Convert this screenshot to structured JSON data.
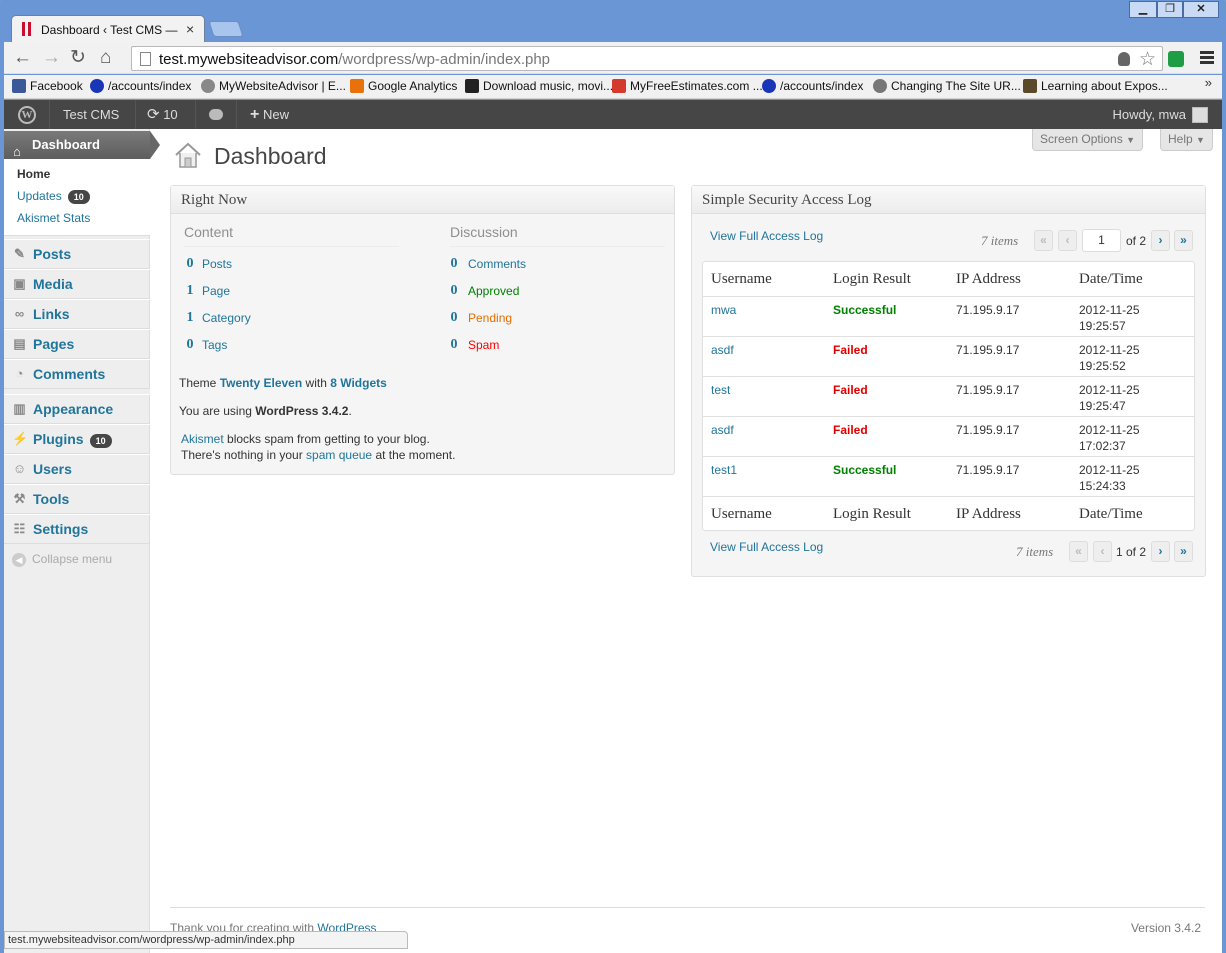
{
  "browser": {
    "tab_title": "Dashboard ‹ Test CMS — Wo",
    "url_host": "test.mywebsiteadvisor.com",
    "url_path": "/wordpress/wp-admin/index.php",
    "status_url": "test.mywebsiteadvisor.com/wordpress/wp-admin/index.php",
    "bookmarks": [
      {
        "label": "Facebook",
        "icon": "facebook-icon",
        "color": "#3b5998"
      },
      {
        "label": "/accounts/index",
        "icon": "e-icon",
        "color": "#1a36b8"
      },
      {
        "label": "MyWebsiteAdvisor | E...",
        "icon": "gear-icon",
        "color": "#888888"
      },
      {
        "label": "Google Analytics",
        "icon": "analytics-icon",
        "color": "#e8710a"
      },
      {
        "label": "Download music, movi...",
        "icon": "invader-icon",
        "color": "#222222"
      },
      {
        "label": "MyFreeEstimates.com ...",
        "icon": "rainbow-icon",
        "color": "#d33a2c"
      },
      {
        "label": "/accounts/index",
        "icon": "e-icon",
        "color": "#1a36b8"
      },
      {
        "label": "Changing The Site UR...",
        "icon": "wordpress-icon",
        "color": "#777777"
      },
      {
        "label": "Learning about Expos...",
        "icon": "ds-icon",
        "color": "#5b4a2a"
      }
    ]
  },
  "adminbar": {
    "site_name": "Test CMS",
    "updates_count": "10",
    "new_label": "New",
    "howdy": "Howdy, mwa"
  },
  "sidebar": {
    "header": "Dashboard",
    "submenu": {
      "home": "Home",
      "updates": "Updates",
      "updates_badge": "10",
      "akismet": "Akismet Stats"
    },
    "items": [
      {
        "label": "Posts",
        "icon": "pin-icon"
      },
      {
        "label": "Media",
        "icon": "media-icon"
      },
      {
        "label": "Links",
        "icon": "link-icon"
      },
      {
        "label": "Pages",
        "icon": "pages-icon"
      },
      {
        "label": "Comments",
        "icon": "comment-icon"
      },
      {
        "label": "Appearance",
        "icon": "appearance-icon"
      },
      {
        "label": "Plugins",
        "icon": "plugin-icon",
        "badge": "10"
      },
      {
        "label": "Users",
        "icon": "users-icon"
      },
      {
        "label": "Tools",
        "icon": "tools-icon"
      },
      {
        "label": "Settings",
        "icon": "settings-icon"
      }
    ],
    "collapse": "Collapse menu"
  },
  "main": {
    "title": "Dashboard",
    "screen_options": "Screen Options",
    "help": "Help",
    "right_now": {
      "title": "Right Now",
      "content_heading": "Content",
      "discussion_heading": "Discussion",
      "content": [
        {
          "count": "0",
          "label": "Posts"
        },
        {
          "count": "1",
          "label": "Page"
        },
        {
          "count": "1",
          "label": "Category"
        },
        {
          "count": "0",
          "label": "Tags"
        }
      ],
      "discussion": [
        {
          "count": "0",
          "label": "Comments",
          "color": "#21759b"
        },
        {
          "count": "0",
          "label": "Approved",
          "color": "#008000"
        },
        {
          "count": "0",
          "label": "Pending",
          "color": "#e66f00"
        },
        {
          "count": "0",
          "label": "Spam",
          "color": "#ff0000"
        }
      ],
      "theme_pre": "Theme",
      "theme_name": "Twenty Eleven",
      "theme_mid": "with",
      "widgets": "8 Widgets",
      "using_pre": "You are using",
      "version_bold": "WordPress 3.4.2",
      "akismet_link": "Akismet",
      "akismet_text": "blocks spam from getting to your blog.",
      "nothing_pre": "There's nothing in your",
      "spam_queue": "spam queue",
      "nothing_post": "at the moment."
    },
    "security_log": {
      "title": "Simple Security Access Log",
      "view_full": "View Full Access Log",
      "items_text": "7 items",
      "page_current": "1",
      "of_pages": "of 2",
      "bottom_pages": "1 of 2",
      "columns": [
        "Username",
        "Login Result",
        "IP Address",
        "Date/Time"
      ],
      "rows": [
        {
          "user": "mwa",
          "result": "Successful",
          "ip": "71.195.9.17",
          "date": "2012-11-25",
          "time": "19:25:57"
        },
        {
          "user": "asdf",
          "result": "Failed",
          "ip": "71.195.9.17",
          "date": "2012-11-25",
          "time": "19:25:52"
        },
        {
          "user": "test",
          "result": "Failed",
          "ip": "71.195.9.17",
          "date": "2012-11-25",
          "time": "19:25:47"
        },
        {
          "user": "asdf",
          "result": "Failed",
          "ip": "71.195.9.17",
          "date": "2012-11-25",
          "time": "17:02:37"
        },
        {
          "user": "test1",
          "result": "Successful",
          "ip": "71.195.9.17",
          "date": "2012-11-25",
          "time": "15:24:33"
        }
      ]
    },
    "footer": {
      "thanks": "Thank you for creating with",
      "wp_link": "WordPress",
      "version": "Version 3.4.2"
    }
  },
  "colors": {
    "success": "#008000",
    "failed": "#e00000",
    "link": "#21759b",
    "adminbar": "#464646"
  }
}
